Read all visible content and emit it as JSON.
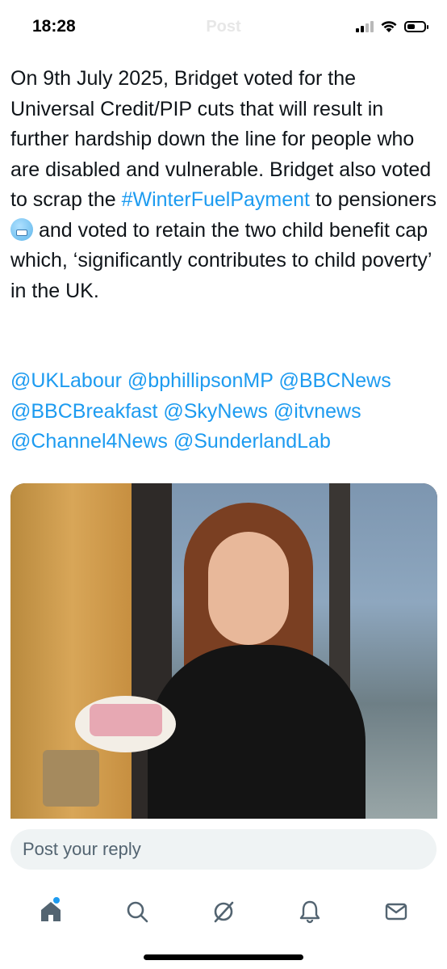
{
  "status_bar": {
    "time": "18:28"
  },
  "header": {
    "title": "Post"
  },
  "tweet": {
    "text_before": "On 9th July 2025, Bridget voted for the Universal Credit/PIP cuts that will result in further hardship down the line for people who are disabled and vulnerable. Bridget also voted to scrap the ",
    "hashtag": "#WinterFuelPayment",
    "text_middle": " to pensioners ",
    "emoji": "cold-face-emoji",
    "text_after": " and voted to retain the two child benefit cap which, ‘significantly contributes to child poverty’ in the UK.",
    "mentions": [
      "@UKLabour",
      "@bphillipsonMP",
      "@BBCNews",
      "@BBCBreakfast",
      "@SkyNews",
      "@itvnews",
      "@Channel4News",
      "@SunderlandLab"
    ]
  },
  "reply": {
    "placeholder": "Post your reply"
  },
  "tabs": [
    {
      "name": "home-icon"
    },
    {
      "name": "search-icon"
    },
    {
      "name": "grok-icon"
    },
    {
      "name": "notifications-icon"
    },
    {
      "name": "messages-icon"
    }
  ],
  "colors": {
    "link": "#1d9bf0",
    "text": "#0f1419",
    "reply_bg": "#eff3f4"
  }
}
